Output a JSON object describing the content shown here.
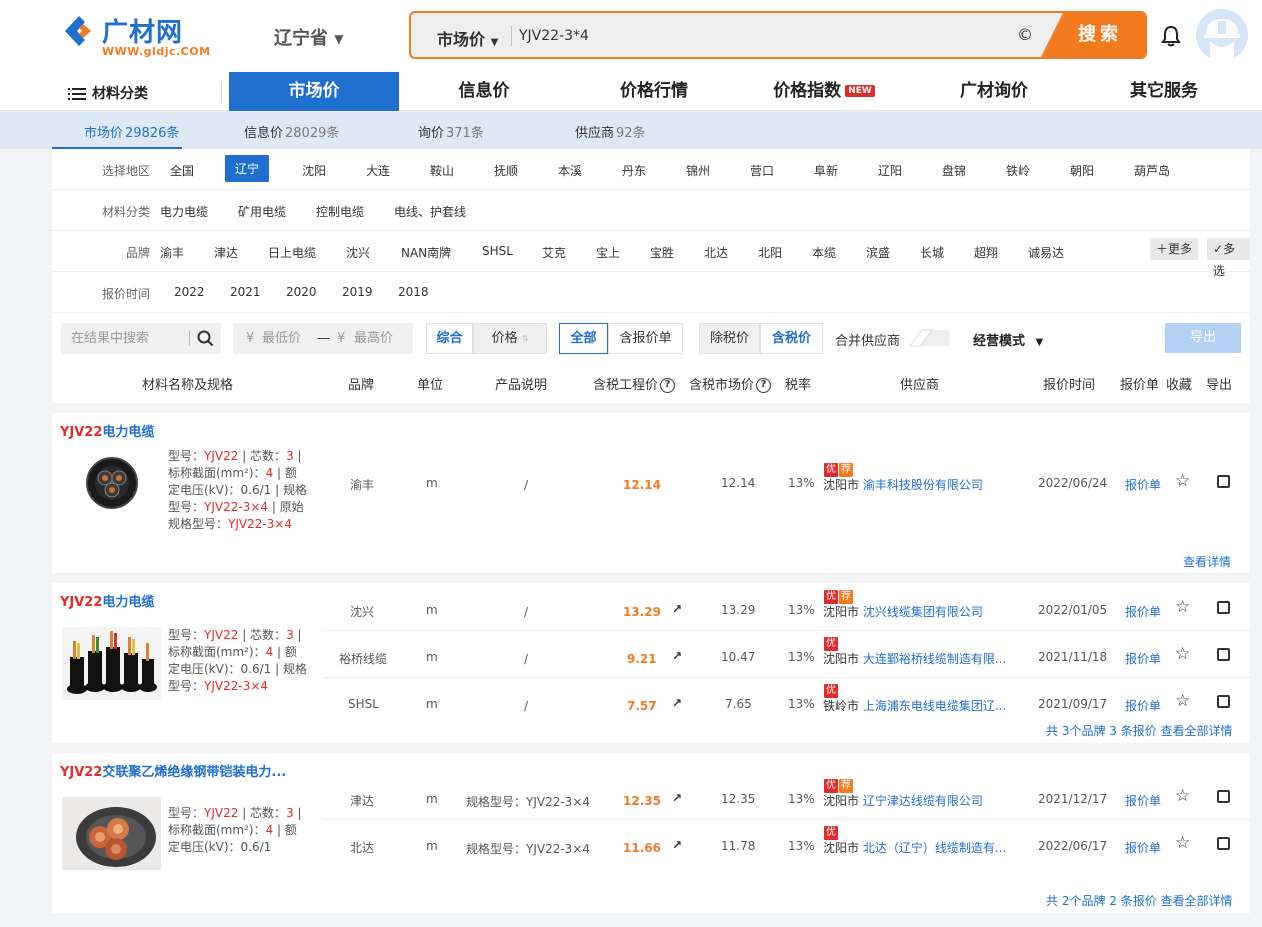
{
  "header": {
    "logo_name": "广材网",
    "logo_url": "WWW.gldjc.COM",
    "region": "辽宁省",
    "search_type": "市场价",
    "search_value": "YJV22-3*4",
    "copyright_glyph": "©",
    "search_button": "搜索"
  },
  "nav": {
    "category": "材料分类",
    "items": [
      "市场价",
      "信息价",
      "价格行情",
      "价格指数",
      "广材询价",
      "其它服务"
    ],
    "new_badge": "NEW"
  },
  "subtabs": [
    {
      "label": "市场价",
      "count": "29826条"
    },
    {
      "label": "信息价",
      "count": "28029条"
    },
    {
      "label": "询价",
      "count": "371条"
    },
    {
      "label": "供应商",
      "count": "92条"
    }
  ],
  "filters": {
    "region_label": "选择地区",
    "regions": [
      "全国",
      "辽宁",
      "沈阳",
      "大连",
      "鞍山",
      "抚顺",
      "本溪",
      "丹东",
      "锦州",
      "营口",
      "阜新",
      "辽阳",
      "盘锦",
      "铁岭",
      "朝阳",
      "葫芦岛"
    ],
    "category_label": "材料分类",
    "categories": [
      "电力电缆",
      "矿用电缆",
      "控制电缆",
      "电线、护套线"
    ],
    "brand_label": "品牌",
    "brands": [
      "渝丰",
      "津达",
      "日上电缆",
      "沈兴",
      "NAN南牌",
      "SHSL",
      "艾克",
      "宝上",
      "宝胜",
      "北达",
      "北阳",
      "本缆",
      "滨盛",
      "长城",
      "超翔",
      "诚易达"
    ],
    "more": "更多",
    "multi": "多选",
    "time_label": "报价时间",
    "years": [
      "2022",
      "2021",
      "2020",
      "2019",
      "2018"
    ]
  },
  "toolbar": {
    "search_placeholder": "在结果中搜索",
    "yen": "¥",
    "min_price": "最低价",
    "dash": "—",
    "max_price": "最高价",
    "sort_overall": "综合",
    "sort_price": "价格",
    "all": "全部",
    "with_quote": "含报价单",
    "ex_tax": "除税价",
    "inc_tax": "含税价",
    "merge": "合并供应商",
    "mode": "经营模式",
    "export": "导出"
  },
  "columns": {
    "name": "材料名称及规格",
    "brand": "品牌",
    "unit": "单位",
    "desc": "产品说明",
    "eng_price": "含税工程价",
    "mkt_price": "含税市场价",
    "tax": "税率",
    "supplier": "供应商",
    "time": "报价时间",
    "quote": "报价单",
    "fav": "收藏",
    "export": "导出",
    "help": "?"
  },
  "cards": [
    {
      "kw": "YJV22",
      "title": "电力电缆",
      "desc": {
        "model_label": "型号：",
        "model": "YJV22",
        "cores_label": " | 芯数：",
        "cores": "3",
        "rest1": " | 标称截面(mm²)：",
        "area": "4",
        "rest2": " | 额定电压(kV)：0.6/1 | 规格型号：",
        "spec": "YJV22-3×4",
        "rest3": " | 原始规格型号：",
        "orig": "YJV22-3×4"
      },
      "rows": [
        {
          "brand": "渝丰",
          "unit": "m",
          "desc": "/",
          "eng": "12.14",
          "mkt": "12.14",
          "tax": "13%",
          "city": "沈阳市",
          "supplier": "渝丰科技股份有限公司",
          "time": "2022/06/24",
          "quote": "报价单",
          "tags": [
            "优",
            "荐"
          ]
        }
      ],
      "footer": "查看详情"
    },
    {
      "kw": "YJV22",
      "title": "电力电缆",
      "desc": {
        "model_label": "型号：",
        "model": "YJV22",
        "cores_label": " | 芯数：",
        "cores": "3",
        "rest1": " | 标称截面(mm²)：",
        "area": "4",
        "rest2": " | 额定电压(kV)：0.6/1 | 规格型号：",
        "spec": "YJV22-3×4"
      },
      "rows": [
        {
          "brand": "沈兴",
          "unit": "m",
          "desc": "/",
          "eng": "13.29",
          "mkt": "13.29",
          "tax": "13%",
          "city": "沈阳市",
          "supplier": "沈兴线缆集团有限公司",
          "time": "2022/01/05",
          "quote": "报价单",
          "tags": [
            "优",
            "荐"
          ]
        },
        {
          "brand": "裕桥线缆",
          "unit": "m",
          "desc": "/",
          "eng": "9.21",
          "mkt": "10.47",
          "tax": "13%",
          "city": "沈阳市",
          "supplier": "大连鄞裕桥线缆制造有限...",
          "time": "2021/11/18",
          "quote": "报价单",
          "tags": [
            "优"
          ]
        },
        {
          "brand": "SHSL",
          "unit": "m",
          "desc": "/",
          "eng": "7.57",
          "mkt": "7.65",
          "tax": "13%",
          "city": "铁岭市",
          "supplier": "上海浦东电线电缆集团辽...",
          "time": "2021/09/17",
          "quote": "报价单",
          "tags": [
            "优"
          ]
        }
      ],
      "footer": "共 3个品牌 3 条报价 查看全部详情"
    },
    {
      "kw": "YJV22",
      "title": "交联聚乙烯绝缘钢带铠装电力...",
      "desc": {
        "model_label": "型号：",
        "model": "YJV22",
        "cores_label": " | 芯数：",
        "cores": "3",
        "rest1": " | 标称截面(mm²)：",
        "area": "4",
        "rest2": " | 额定电压(kV)：0.6/1"
      },
      "rows": [
        {
          "brand": "津达",
          "unit": "m",
          "desc": "规格型号：YJV22-3×4",
          "eng": "12.35",
          "mkt": "12.35",
          "tax": "13%",
          "city": "沈阳市",
          "supplier": "辽宁津达线缆有限公司",
          "time": "2021/12/17",
          "quote": "报价单",
          "tags": [
            "优",
            "荐"
          ]
        },
        {
          "brand": "北达",
          "unit": "m",
          "desc": "规格型号：YJV22-3×4",
          "eng": "11.66",
          "mkt": "11.78",
          "tax": "13%",
          "city": "沈阳市",
          "supplier": "北达（辽宁）线缆制造有...",
          "time": "2022/06/17",
          "quote": "报价单",
          "tags": [
            "优"
          ]
        }
      ],
      "footer": "共 2个品牌 2 条报价 查看全部详情"
    }
  ],
  "icons": {
    "trend": "↗",
    "star": "☆",
    "more_plus": "＋",
    "check": "✓"
  },
  "colors": {
    "brand_blue": "#1f6fd1",
    "brand_orange": "#f47a1f",
    "red": "#e02b2b"
  }
}
